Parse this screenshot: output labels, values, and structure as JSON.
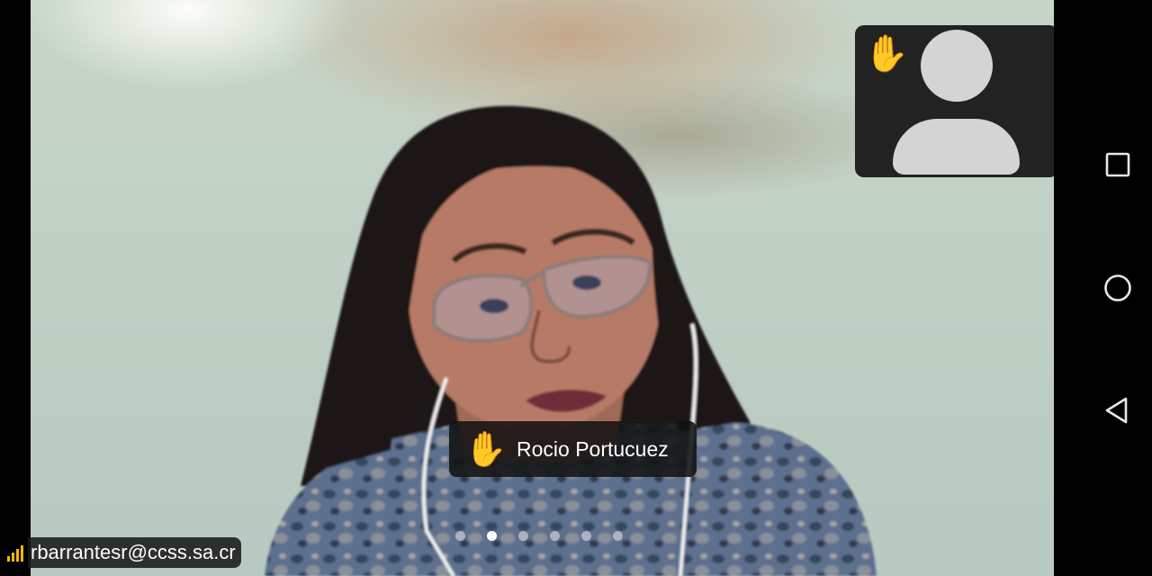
{
  "main_video": {
    "participant_name": "Rocio Portucuez",
    "raised_hand_icon": "raised-hand-emoji",
    "raised_hand_glyph": "✋"
  },
  "self_view": {
    "raised_hand_icon": "raised-hand-emoji",
    "raised_hand_glyph": "✋",
    "avatar_icon": "person-silhouette-icon"
  },
  "pagination": {
    "total_pages": 6,
    "active_page": 2
  },
  "account": {
    "email": "rbarrantesr@ccss.sa.cr",
    "signal_icon": "signal-bars-icon"
  },
  "system_nav": {
    "recents_icon": "square-icon",
    "home_icon": "circle-icon",
    "back_icon": "triangle-back-icon"
  },
  "colors": {
    "tile_background": "#222222",
    "avatar_gray": "#d4d4d4",
    "signal_yellow": "#f2b800"
  }
}
